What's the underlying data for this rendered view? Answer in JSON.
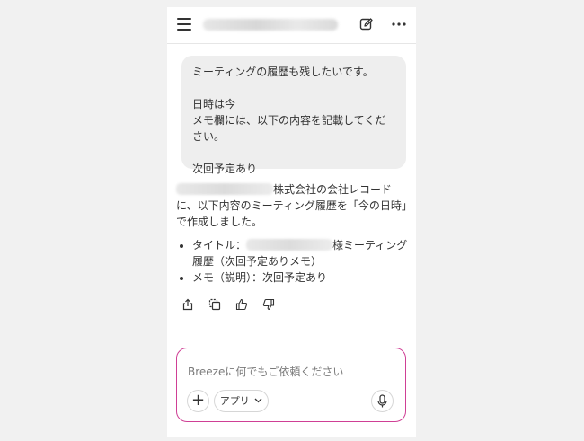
{
  "header": {
    "menu_icon": "hamburger-menu-icon",
    "edit_icon": "edit-note-icon",
    "more_icon": "more-horizontal-icon"
  },
  "user_message": {
    "line1": "ミーティングの履歴も残したいです。",
    "line2": "日時は今",
    "line3": "メモ欄には、以下の内容を記載してください。",
    "line4": "次回予定あり"
  },
  "assistant_message": {
    "intro_after_redaction": "株式会社の会社レコードに、以下内容のミーティング履歴を「今の日時」で作成しました。",
    "bullet1_prefix": "タイトル：",
    "bullet1_suffix": "様ミーティング履歴（次回予定ありメモ）",
    "bullet2": "メモ（説明）：次回予定あり"
  },
  "actions": [
    "share-icon",
    "copy-icon",
    "thumbs-up-icon",
    "thumbs-down-icon"
  ],
  "composer": {
    "placeholder": "Breezeに何でもご依頼ください",
    "plus_label": "+",
    "app_label": "アプリ",
    "accent_color": "#cf3f95"
  }
}
